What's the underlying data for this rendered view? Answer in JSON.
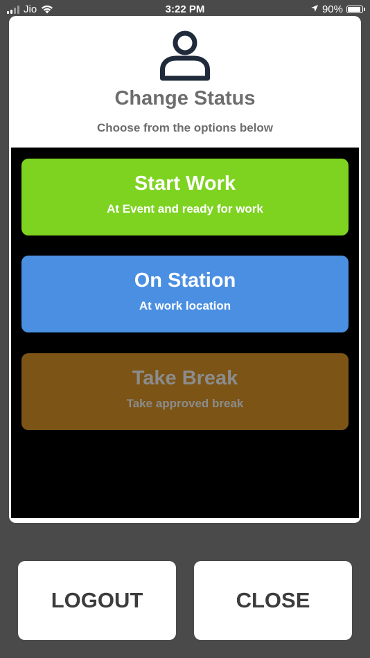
{
  "status_bar": {
    "carrier": "Jio",
    "time": "3:22 PM",
    "battery": "90%",
    "battery_level": 0.9,
    "icons": [
      "signal-icon",
      "wifi-icon",
      "location-arrow-icon",
      "battery-icon"
    ]
  },
  "modal": {
    "icon": "person-icon",
    "title": "Change Status",
    "subtitle": "Choose from the options below",
    "options": [
      {
        "title": "Start Work",
        "subtitle": "At Event and ready for work",
        "color": "#7ED321",
        "text_color": "#FFFFFF"
      },
      {
        "title": "On Station",
        "subtitle": "At work location",
        "color": "#4A8FE2",
        "text_color": "#FFFFFF"
      },
      {
        "title": "Take Break",
        "subtitle": "Take approved break",
        "color": "#7B5416",
        "text_color": "#8C8C8C"
      }
    ]
  },
  "actions": {
    "logout": "LOGOUT",
    "close": "CLOSE"
  },
  "colors": {
    "background": "#4A4A4A",
    "header_text": "#6D6D6D",
    "icon": "#1F2A3A"
  }
}
